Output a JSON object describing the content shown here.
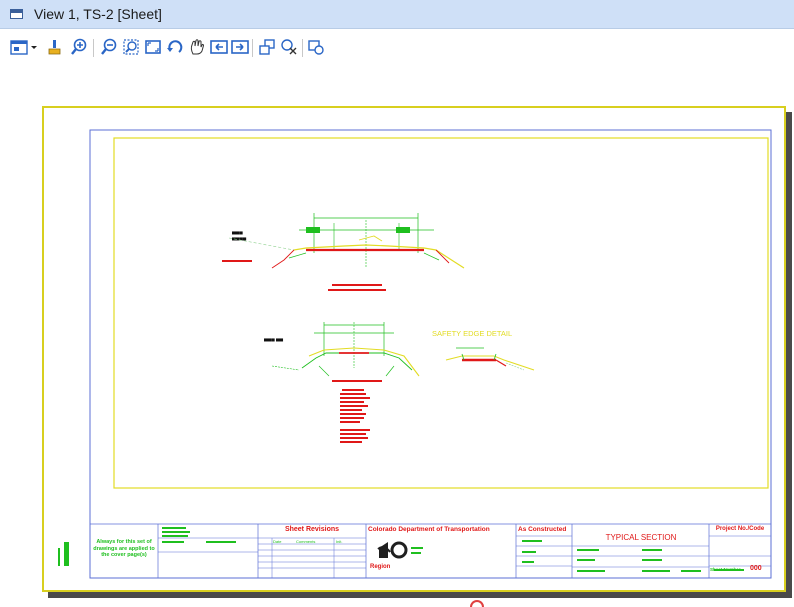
{
  "window": {
    "title": "View 1, TS-2 [Sheet]"
  },
  "toolbar": {
    "icons": [
      "view-attributes-icon",
      "dropdown-arrow-icon",
      "update-view-icon",
      "zoom-in-icon",
      "zoom-out-icon",
      "window-area-icon",
      "fit-view-icon",
      "rotate-view-icon",
      "pan-view-icon",
      "previous-view-icon",
      "next-view-icon",
      "copy-view-icon",
      "clip-volume-icon",
      "view-display-icon"
    ]
  },
  "sheet": {
    "title_block": {
      "left_note": "Always for this set of drawings are applied to the cover page(s)",
      "revisions_header": "Sheet Revisions",
      "revision_cols": [
        "Date",
        "Comments",
        "Init."
      ],
      "department": "Colorado Department of Transportation",
      "region_label": "Region",
      "as_constructed": "As Constructed",
      "sheet_title": "TYPICAL SECTION",
      "project_no": "Project No./Code",
      "sheet_number_label": "Sheet Number",
      "sheet_number": "000"
    },
    "annotations": {
      "safety_edge": "SAFETY EDGE DETAIL"
    }
  },
  "colors": {
    "border_yellow": "#d8cf1f",
    "frame_blue": "#5b6fd6",
    "cad_green": "#1fbf1f",
    "cad_red": "#e01818",
    "cad_yellow": "#e2dc24"
  }
}
